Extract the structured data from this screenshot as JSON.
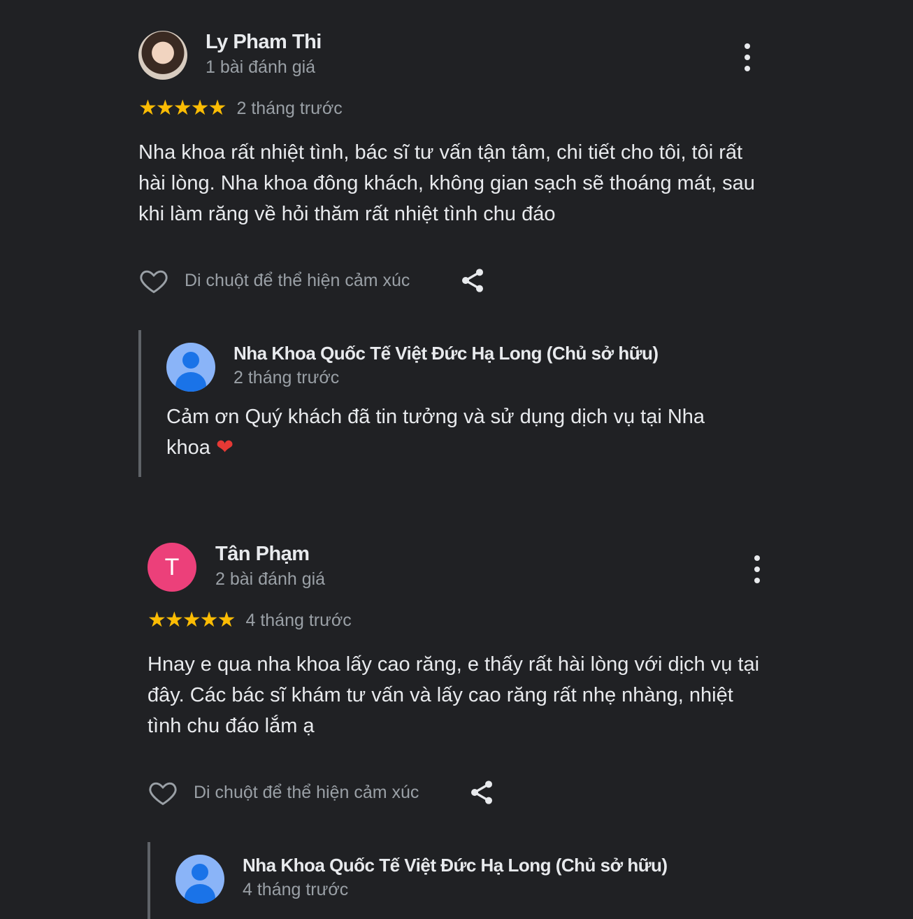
{
  "reviews": [
    {
      "author": "Ly Pham Thi",
      "review_count": "1 bài đánh giá",
      "avatar": "user-photo",
      "stars": "★★★★★",
      "rating": 5,
      "time": "2 tháng trước",
      "text": "Nha khoa rất nhiệt tình, bác sĩ tư vấn tận tâm, chi tiết cho tôi, tôi rất hài lòng. Nha khoa đông khách, không gian sạch sẽ thoáng mát, sau khi làm răng về hỏi thăm rất nhiệt tình chu đáo",
      "react_label": "Di chuột để thể hiện cảm xúc",
      "reply": {
        "owner": "Nha Khoa Quốc Tế Việt Đức Hạ Long (Chủ sở hữu)",
        "time": "2 tháng trước",
        "text": "Cảm ơn Quý khách đã tin tưởng và sử dụng dịch vụ tại Nha khoa",
        "emoji": "❤"
      }
    },
    {
      "author": "Tân Phạm",
      "review_count": "2 bài đánh giá",
      "avatar_letter": "T",
      "avatar_color": "#ec407a",
      "stars": "★★★★★",
      "rating": 5,
      "time": "4 tháng trước",
      "text": "Hnay e qua nha khoa lấy cao răng, e thấy rất hài lòng với dịch vụ tại đây. Các bác sĩ khám tư vấn và lấy cao răng rất nhẹ nhàng, nhiệt tình chu đáo lắm ạ",
      "react_label": "Di chuột để thể hiện cảm xúc",
      "reply": {
        "owner": "Nha Khoa Quốc Tế Việt Đức Hạ Long (Chủ sở hữu)",
        "time": "4 tháng trước"
      }
    }
  ],
  "colors": {
    "background": "#202124",
    "star": "#fbbc04",
    "secondary_text": "#9aa0a6",
    "owner_avatar": "#8ab4f8"
  },
  "icons": [
    "heart-icon",
    "share-icon",
    "more-vert-icon",
    "star-icon",
    "person-icon"
  ]
}
